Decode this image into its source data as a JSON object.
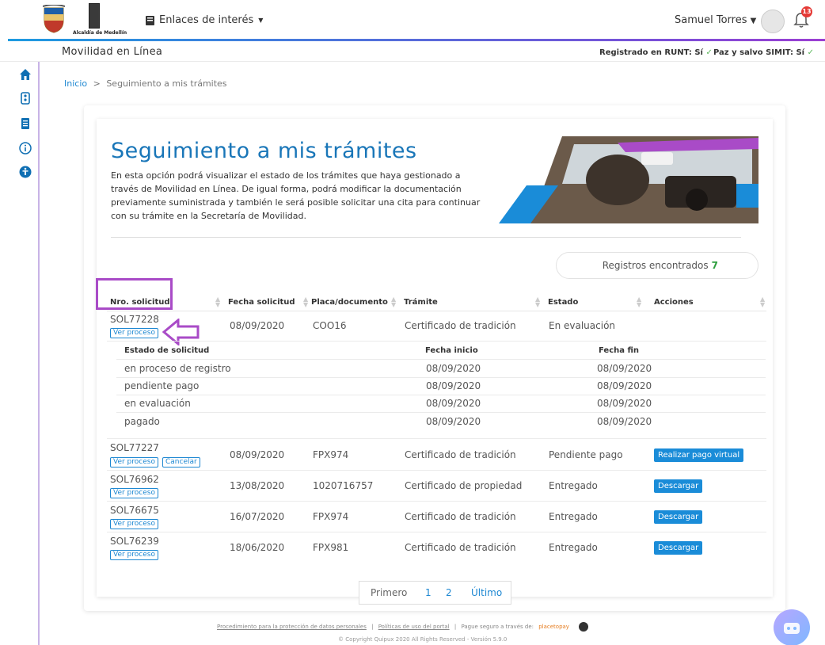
{
  "topbar": {
    "logo_text": "Alcaldía de Medellín",
    "links_label": "Enlaces de interés",
    "user_name": "Samuel Torres",
    "notifications_count": "13"
  },
  "subheader": {
    "brand": "Movilidad en Línea",
    "runt_label": "Registrado en RUNT: Sí",
    "simit_label": "Paz y salvo SIMIT: Sí",
    "check": "✓"
  },
  "breadcrumb": {
    "home": "Inicio",
    "separator": ">",
    "current": "Seguimiento a mis trámites"
  },
  "page": {
    "title": "Seguimiento a mis trámites",
    "description": "En esta opción podrá visualizar el estado de los trámites que haya gestionado a través de Movilidad en Línea. De igual forma, podrá modificar la documentación previamente suministrada y también le será posible solicitar una cita para continuar con su trámite en la Secretaría de Movilidad."
  },
  "records": {
    "label": "Registros encontrados",
    "count": "7"
  },
  "table": {
    "headers": [
      "Nro. solicitud",
      "Fecha solicitud",
      "Placa/documento",
      "Trámite",
      "Estado",
      "Acciones"
    ],
    "rows": [
      {
        "id": "SOL77228",
        "date": "08/09/2020",
        "plate": "COO16",
        "procedure": "Certificado de tradición",
        "status": "En evaluación",
        "view": "Ver proceso"
      },
      {
        "id": "SOL77227",
        "date": "08/09/2020",
        "plate": "FPX974",
        "procedure": "Certificado de tradición",
        "status": "Pendiente pago",
        "view": "Ver proceso",
        "cancel": "Cancelar",
        "action": "Realizar pago virtual"
      },
      {
        "id": "SOL76962",
        "date": "13/08/2020",
        "plate": "1020716757",
        "procedure": "Certificado de propiedad",
        "status": "Entregado",
        "view": "Ver proceso",
        "action": "Descargar"
      },
      {
        "id": "SOL76675",
        "date": "16/07/2020",
        "plate": "FPX974",
        "procedure": "Certificado de tradición",
        "status": "Entregado",
        "view": "Ver proceso",
        "action": "Descargar"
      },
      {
        "id": "SOL76239",
        "date": "18/06/2020",
        "plate": "FPX981",
        "procedure": "Certificado de tradición",
        "status": "Entregado",
        "view": "Ver proceso",
        "action": "Descargar"
      }
    ],
    "detail": {
      "headers": [
        "Estado de solicitud",
        "Fecha inicio",
        "Fecha fin"
      ],
      "rows": [
        {
          "state": "en proceso de registro",
          "start": "08/09/2020",
          "end": "08/09/2020"
        },
        {
          "state": "pendiente pago",
          "start": "08/09/2020",
          "end": "08/09/2020"
        },
        {
          "state": "en evaluación",
          "start": "08/09/2020",
          "end": "08/09/2020"
        },
        {
          "state": "pagado",
          "start": "08/09/2020",
          "end": "08/09/2020"
        }
      ]
    }
  },
  "pagination": {
    "first": "Primero",
    "p1": "1",
    "p2": "2",
    "last": "Último"
  },
  "footer": {
    "link1": "Procedimiento para la protección de datos personales",
    "link2": "Políticas de uso del portal",
    "sep": "|",
    "pay_text": "Pague seguro a través de:",
    "pay_brand": "placetopay",
    "copyright": "© Copyright Quipux 2020 All Rights Reserved - Versión 5.9.0"
  },
  "colors": {
    "accent": "#1976b8",
    "highlight": "#a94bc7",
    "action": "#1a8cd8",
    "success": "#2e9e3e"
  }
}
